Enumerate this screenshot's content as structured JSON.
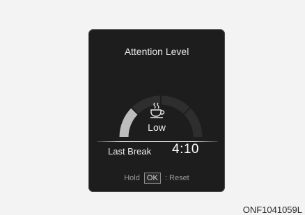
{
  "panel": {
    "title": "Attention Level",
    "level_text": "Low",
    "gauge_level": 0.25,
    "last_break_label": "Last Break",
    "last_break_time": "4:10",
    "hold_label": "Hold",
    "ok_label": "OK",
    "reset_label": ": Reset",
    "icon": "coffee-cup-icon"
  },
  "figure_code": "ONF1041059L",
  "colors": {
    "panel_bg": "#1d1d1d",
    "gauge_track": "#2e2e2e",
    "gauge_fill": "#bdbdbd"
  }
}
